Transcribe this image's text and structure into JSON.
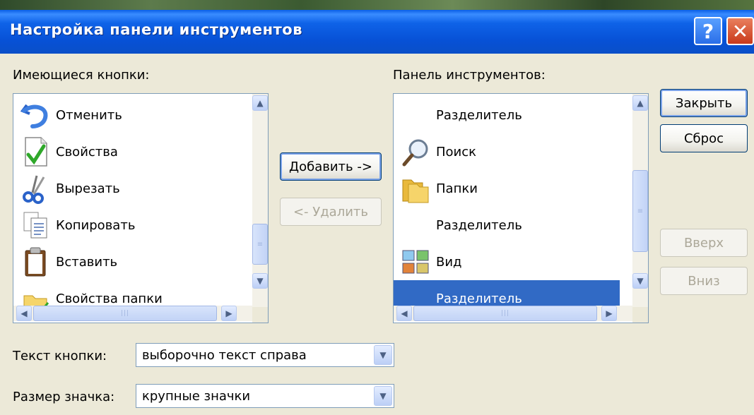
{
  "window": {
    "title": "Настройка панели инструментов",
    "help_glyph": "?",
    "close_glyph": "✕"
  },
  "available": {
    "label": "Имеющиеся кнопки:",
    "items": [
      {
        "label": "Отменить",
        "icon": "undo-icon"
      },
      {
        "label": "Свойства",
        "icon": "properties-icon"
      },
      {
        "label": "Вырезать",
        "icon": "cut-icon"
      },
      {
        "label": "Копировать",
        "icon": "copy-icon"
      },
      {
        "label": "Вставить",
        "icon": "paste-icon"
      },
      {
        "label": "Свойства папки",
        "icon": "folder-options-icon"
      }
    ]
  },
  "toolbar_list": {
    "label": "Панель инструментов:",
    "items": [
      {
        "label": "Разделитель",
        "icon": ""
      },
      {
        "label": "Поиск",
        "icon": "search-icon"
      },
      {
        "label": "Папки",
        "icon": "folders-icon"
      },
      {
        "label": "Разделитель",
        "icon": ""
      },
      {
        "label": "Вид",
        "icon": "view-icon"
      },
      {
        "label": "Разделитель",
        "icon": "",
        "selected": true
      }
    ]
  },
  "buttons": {
    "add": "Добавить ->",
    "remove": "<- Удалить",
    "close": "Закрыть",
    "reset": "Сброс",
    "up": "Вверх",
    "down": "Вниз"
  },
  "options": {
    "text_label": "Текст кнопки:",
    "text_value": "выборочно текст справа",
    "size_label": "Размер значка:",
    "size_value": "крупные значки"
  },
  "colors": {
    "titlebar": "#0a52d8",
    "selection": "#316ac5",
    "dialog_bg": "#ece9d8"
  }
}
